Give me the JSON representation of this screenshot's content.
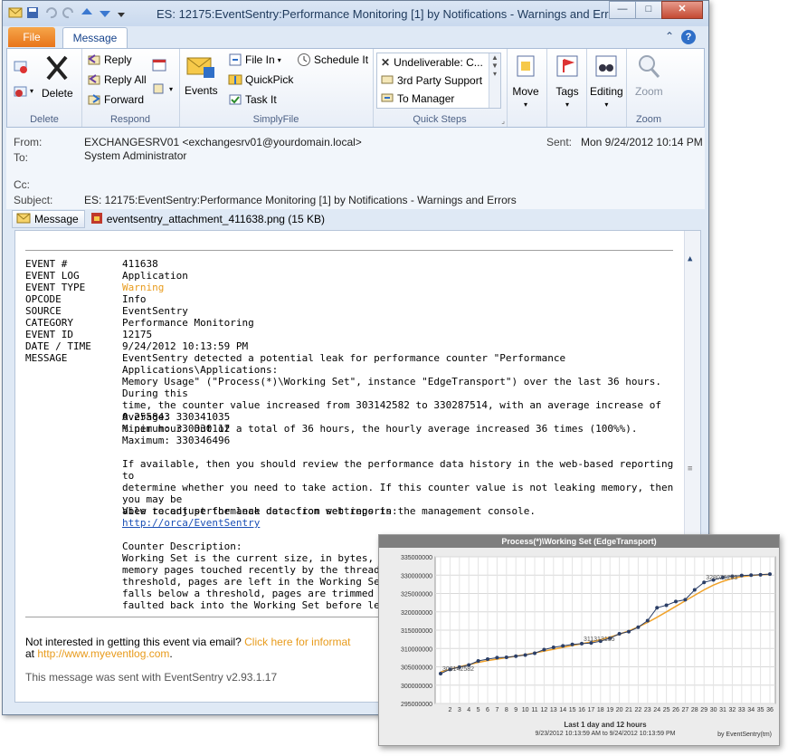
{
  "window": {
    "title": "ES: 12175:EventSentry:Performance Monitoring [1] by Notifications - Warnings and Errors",
    "buttons": {
      "minimize": "—",
      "maximize": "□",
      "close": "✕"
    }
  },
  "tabs": {
    "file": "File",
    "message": "Message"
  },
  "ribbon": {
    "delete_group": {
      "label": "Delete",
      "delete": "Delete"
    },
    "respond_group": {
      "label": "Respond",
      "reply": "Reply",
      "reply_all": "Reply All",
      "forward": "Forward"
    },
    "simplyfile_group": {
      "label": "SimplyFile",
      "events": "Events",
      "file_in": "File In",
      "schedule": "Schedule It",
      "quickpick": "QuickPick",
      "task": "Task It"
    },
    "quicksteps_group": {
      "label": "Quick Steps",
      "items": [
        "Undeliverable: C...",
        "3rd Party Support",
        "To Manager"
      ]
    },
    "move": "Move",
    "tags": "Tags",
    "editing": "Editing",
    "zoom_group": {
      "label": "Zoom",
      "zoom": "Zoom"
    }
  },
  "header": {
    "from_label": "From:",
    "from": "EXCHANGESRV01 <exchangesrv01@yourdomain.local>",
    "sent_label": "Sent:",
    "sent": "Mon 9/24/2012 10:14 PM",
    "to_label": "To:",
    "to": "System Administrator",
    "cc_label": "Cc:",
    "subject_label": "Subject:",
    "subject": "ES: 12175:EventSentry:Performance Monitoring [1] by Notifications - Warnings and Errors",
    "message_tab": "Message",
    "attachment": "eventsentry_attachment_411638.png (15 KB)"
  },
  "event": {
    "rows": [
      {
        "k": "EVENT #",
        "v": "411638"
      },
      {
        "k": "EVENT LOG",
        "v": "Application"
      },
      {
        "k": "EVENT TYPE",
        "v": "Warning"
      },
      {
        "k": "OPCODE",
        "v": "Info"
      },
      {
        "k": "SOURCE",
        "v": "EventSentry"
      },
      {
        "k": "CATEGORY",
        "v": "Performance Monitoring"
      },
      {
        "k": "EVENT ID",
        "v": "12175"
      },
      {
        "k": "DATE / TIME",
        "v": "9/24/2012 10:13:59 PM"
      },
      {
        "k": "MESSAGE",
        "v": ""
      }
    ],
    "message_lines": [
      "EventSentry detected a potential leak for performance counter \"Performance Applications\\Applications:",
      "Memory Usage\" (\"Process(*)\\Working Set\", instance \"EdgeTransport\") over the last 36 hours. During this",
      "time, the counter value increased from 303142582 to 330287514, with an average increase of 0.255843",
      "% per hour. Out of a total of 36 hours, the hourly average increased 36 times (100%%)."
    ],
    "stats": [
      "Average: 330341035",
      "Minimum: 330330112",
      "Maximum: 330346496"
    ],
    "advice_lines": [
      "If available, then you should review the performance data history in the web-based reporting to",
      "determine whether you need to take action. If this counter value is not leaking memory, then you may be",
      "able to adjust the leak detection settings in the management console."
    ],
    "view_recent": "View recent performance data from web reports:",
    "link": "http://orca/EventSentry",
    "counter_desc_title": "Counter Description:",
    "counter_desc_lines": [
      "Working Set is the current size, in bytes, of the W",
      "memory pages touched recently by the threads in",
      "threshold, pages are left in the Working Set of a p",
      "falls below a threshold, pages are trimmed from W",
      "faulted back into the Working Set before leaving r"
    ],
    "footer1": "Not interested in getting this event via email? ",
    "footer1_link": "Click here for informat",
    "footer2_prefix": "at ",
    "footer2_link": "http://www.myeventlog.com",
    "footer2_suffix": ".",
    "footer3": "This message was sent with EventSentry v2.93.1.17"
  },
  "chart_data": {
    "type": "line",
    "title": "Process(*)\\Working Set (EdgeTransport)",
    "xlabel": "Last 1 day and 12 hours",
    "subtitle": "9/23/2012 10:13:59 AM to 9/24/2012 10:13:59 PM",
    "credit": "by EventSentry(tm)",
    "x": [
      1,
      2,
      3,
      4,
      5,
      6,
      7,
      8,
      9,
      10,
      11,
      12,
      13,
      14,
      15,
      16,
      17,
      18,
      19,
      20,
      21,
      22,
      23,
      24,
      25,
      26,
      27,
      28,
      29,
      30,
      31,
      32,
      33,
      34,
      35,
      36
    ],
    "values": [
      303142582,
      304300000,
      304900000,
      305500000,
      306600000,
      307100000,
      307500000,
      307600000,
      307900000,
      308200000,
      308700000,
      309700000,
      310300000,
      310700000,
      311100000,
      311313135,
      311500000,
      312000000,
      312800000,
      314000000,
      314600000,
      315800000,
      317600000,
      321100000,
      321800000,
      322800000,
      323300000,
      326000000,
      328026293,
      328700000,
      329400000,
      329700000,
      329900000,
      330000000,
      330100000,
      330287514
    ],
    "trend": [
      303600000,
      304300000,
      305000000,
      305600000,
      306200000,
      306700000,
      307100000,
      307500000,
      307900000,
      308300000,
      308800000,
      309300000,
      309800000,
      310300000,
      310800000,
      311300000,
      311800000,
      312400000,
      313100000,
      313900000,
      314800000,
      315900000,
      317100000,
      318500000,
      320000000,
      321500000,
      323000000,
      324500000,
      326000000,
      327300000,
      328300000,
      329100000,
      329600000,
      329900000,
      330100000,
      330200000
    ],
    "labels": [
      {
        "x": 1,
        "text": "303142582"
      },
      {
        "x": 16,
        "text": "311313135"
      },
      {
        "x": 29,
        "text": "328026293"
      }
    ],
    "ylim": [
      295000000,
      335000000
    ],
    "yticks": [
      "295000000",
      "300000000",
      "305000000",
      "310000000",
      "315000000",
      "320000000",
      "325000000",
      "330000000",
      "335000000"
    ],
    "line_color": "#2b3e66",
    "trend_color": "#f0a22a",
    "grid": true
  }
}
